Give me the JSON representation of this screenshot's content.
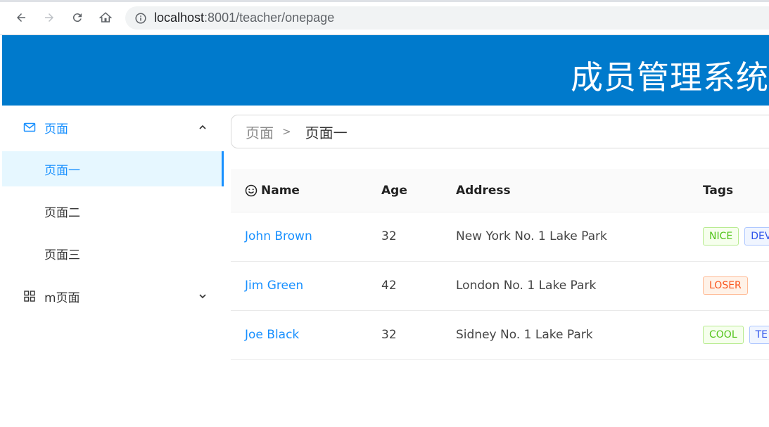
{
  "browser": {
    "url_host": "localhost",
    "url_rest": ":8001/teacher/onepage"
  },
  "header": {
    "title": "成员管理系统"
  },
  "sidebar": {
    "groups": [
      {
        "label": "页面",
        "icon": "mail-icon",
        "expanded": true
      },
      {
        "label": "m页面",
        "icon": "appstore-icon",
        "expanded": false
      }
    ],
    "items": [
      {
        "label": "页面一",
        "active": true
      },
      {
        "label": "页面二",
        "active": false
      },
      {
        "label": "页面三",
        "active": false
      }
    ]
  },
  "breadcrumb": {
    "parent": "页面",
    "separator": ">",
    "current": "页面一"
  },
  "table": {
    "columns": [
      "Name",
      "Age",
      "Address",
      "Tags"
    ],
    "rows": [
      {
        "name": "John Brown",
        "age": "32",
        "address": "New York No. 1 Lake Park",
        "tags": [
          "NICE",
          "DEV"
        ]
      },
      {
        "name": "Jim Green",
        "age": "42",
        "address": "London No. 1 Lake Park",
        "tags": [
          "LOSER"
        ]
      },
      {
        "name": "Joe Black",
        "age": "32",
        "address": "Sidney No. 1 Lake Park",
        "tags": [
          "COOL",
          "TE"
        ]
      }
    ]
  },
  "colors": {
    "header_bg": "#007acc",
    "accent": "#1890ff"
  }
}
